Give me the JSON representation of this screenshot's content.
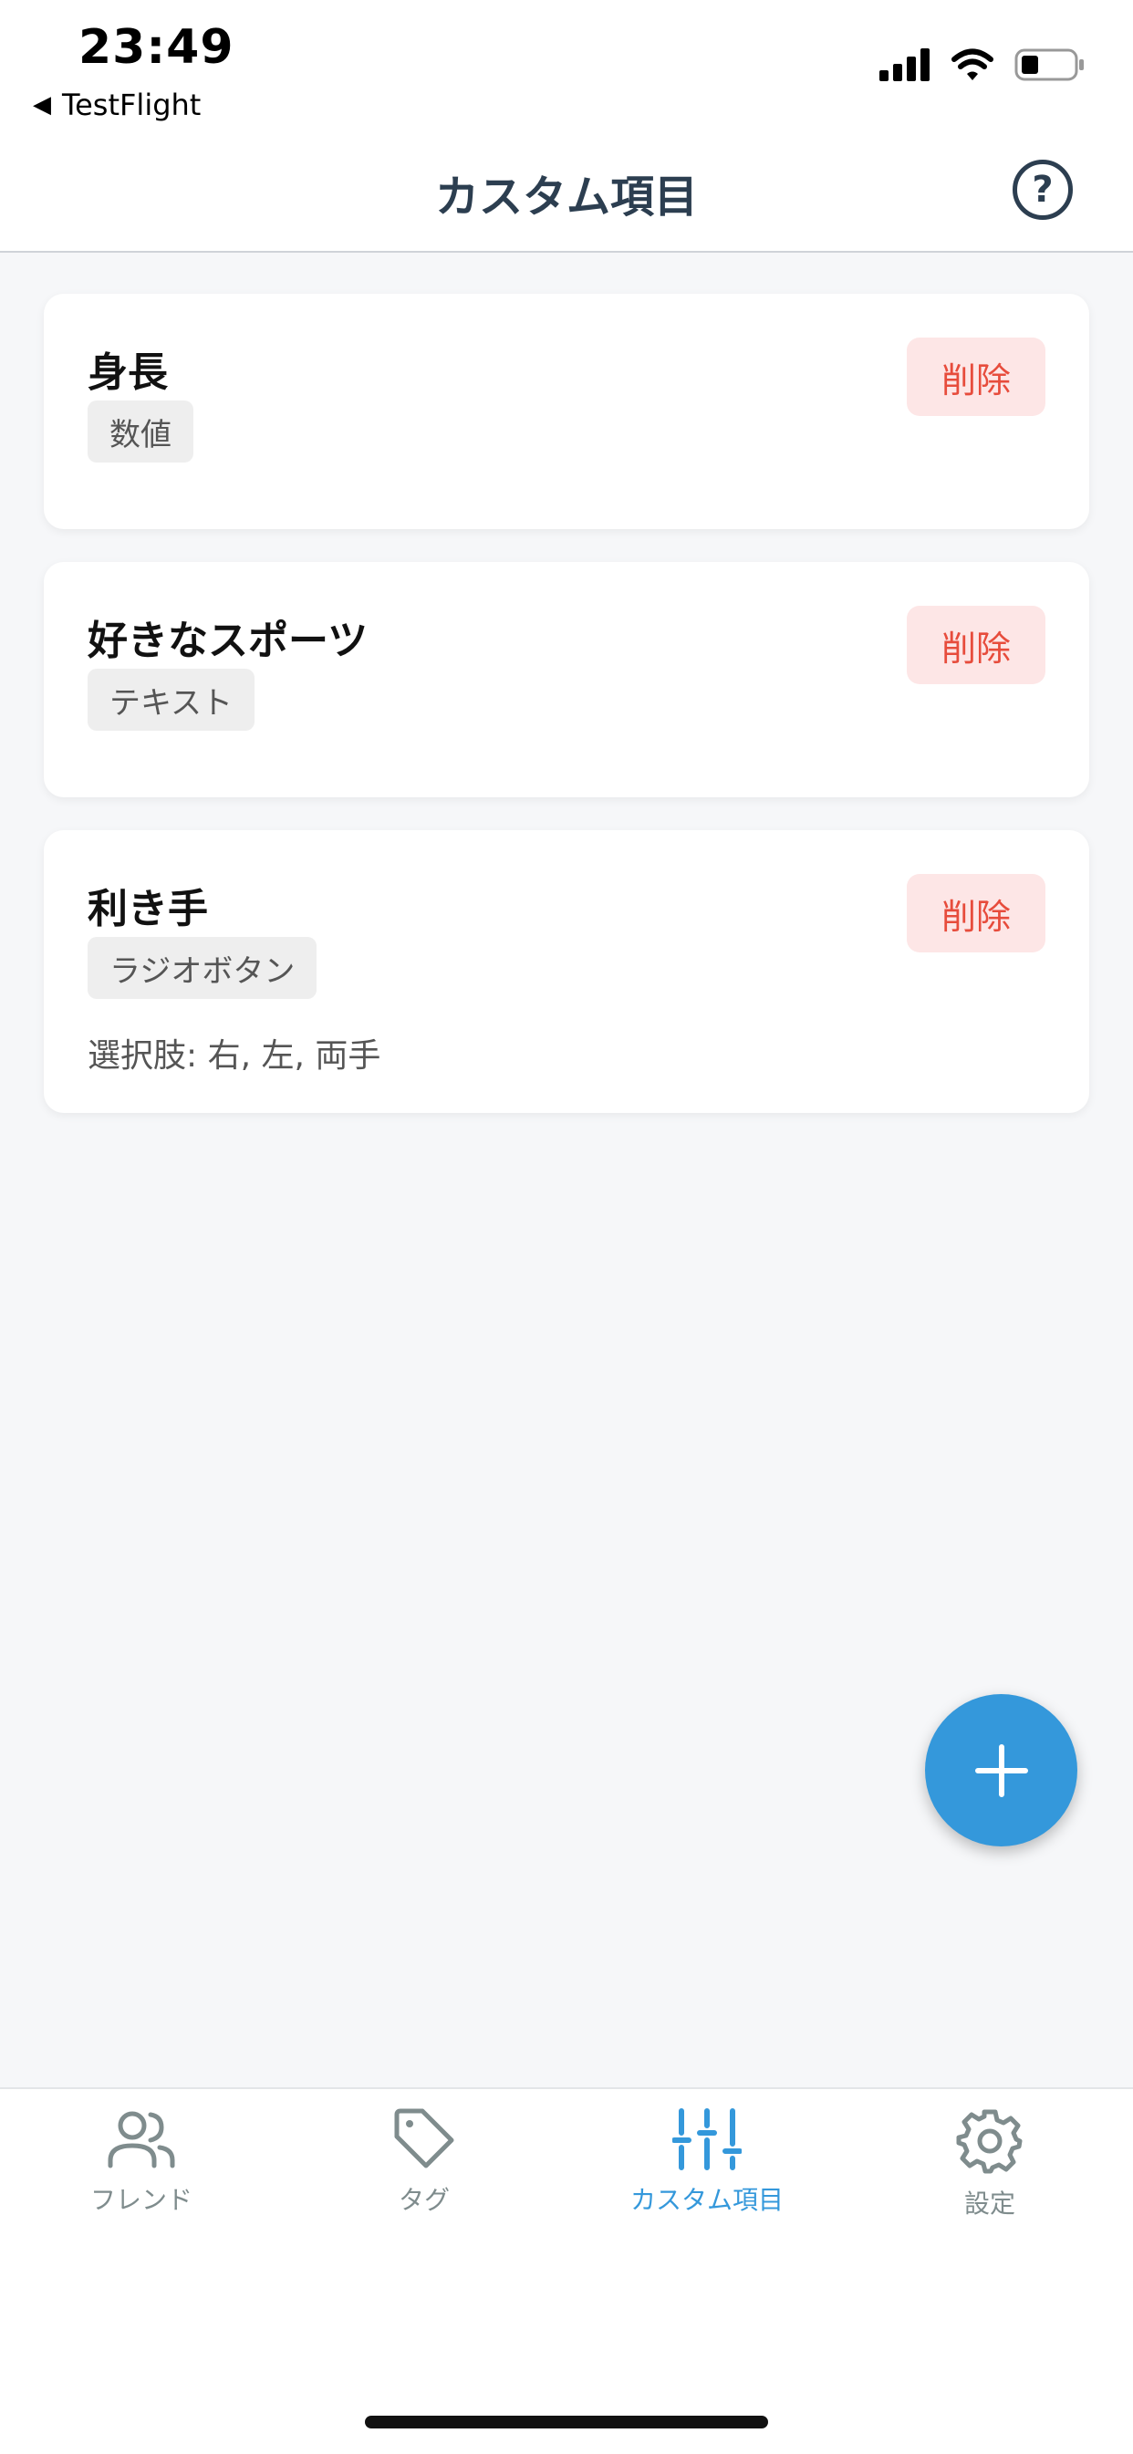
{
  "status_bar": {
    "time": "23:49",
    "back_app": "TestFlight"
  },
  "header": {
    "title": "カスタム項目",
    "help_icon": "question-circle-icon",
    "help_glyph": "?"
  },
  "items": [
    {
      "name": "身長",
      "type": "数値",
      "delete_label": "削除"
    },
    {
      "name": "好きなスポーツ",
      "type": "テキスト",
      "delete_label": "削除"
    },
    {
      "name": "利き手",
      "type": "ラジオボタン",
      "options_text": "選択肢: 右, 左, 両手",
      "delete_label": "削除"
    }
  ],
  "fab": {
    "icon": "plus-icon"
  },
  "tabs": [
    {
      "label": "フレンド",
      "icon": "users-icon",
      "active": false
    },
    {
      "label": "タグ",
      "icon": "tag-icon",
      "active": false
    },
    {
      "label": "カスタム項目",
      "icon": "sliders-icon",
      "active": true
    },
    {
      "label": "設定",
      "icon": "gear-icon",
      "active": false
    }
  ],
  "colors": {
    "accent": "#3498db",
    "title": "#2c3e50",
    "delete_text": "#e74c3c",
    "delete_bg": "#fde6e6",
    "inactive_tab": "#7f8c8d"
  }
}
